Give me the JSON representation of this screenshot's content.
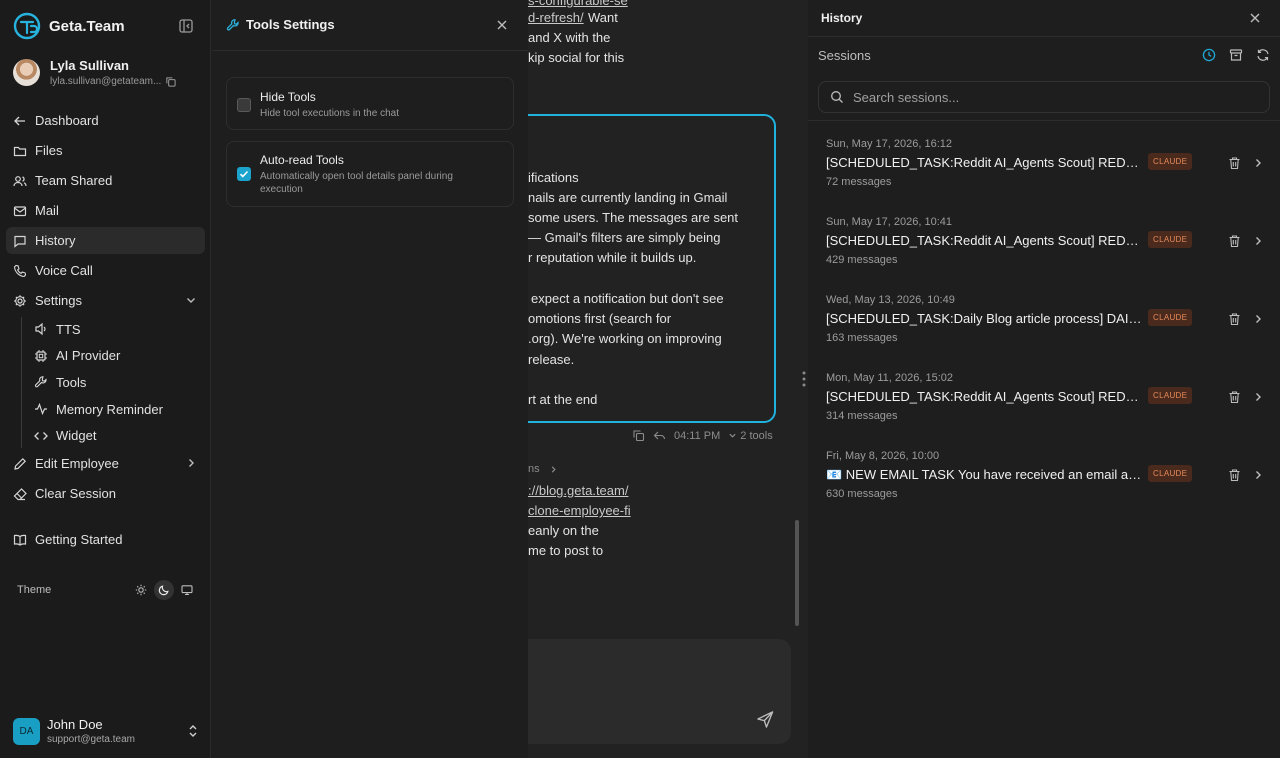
{
  "brand": {
    "name": "Geta.Team"
  },
  "user": {
    "name": "Lyla Sullivan",
    "email": "lyla.sullivan@getateam..."
  },
  "nav": {
    "dashboard": "Dashboard",
    "files": "Files",
    "team_shared": "Team Shared",
    "mail": "Mail",
    "history": "History",
    "voice_call": "Voice Call",
    "settings": "Settings",
    "settings_children": {
      "tts": "TTS",
      "ai_provider": "AI Provider",
      "tools": "Tools",
      "memory_reminder": "Memory Reminder",
      "widget": "Widget"
    },
    "edit_employee": "Edit Employee",
    "clear_session": "Clear Session",
    "getting_started": "Getting Started"
  },
  "theme": {
    "label": "Theme",
    "selected": "dark"
  },
  "account": {
    "initials": "DA",
    "name": "John Doe",
    "email": "support@geta.team"
  },
  "tools_panel": {
    "title": "Tools Settings",
    "options": [
      {
        "title": "Hide Tools",
        "description": "Hide tool executions in the chat",
        "checked": false
      },
      {
        "title": "Auto-read Tools",
        "description": "Automatically open tool details panel during execution",
        "checked": true
      }
    ]
  },
  "chat": {
    "lines_top": [
      {
        "text": "d-refresh/",
        "link": true
      },
      {
        "text": " Want",
        "link": false
      },
      {
        "text": "and X with the",
        "link": false
      },
      {
        "text": "kip social for this",
        "link": false
      }
    ],
    "bubble_lines": [
      "ifications",
      "nails are currently landing in Gmail",
      "some users. The messages are sent",
      "— Gmail's filters are simply being",
      "r reputation while it builds up.",
      "expect a notification but don't see",
      "omotions first (search for",
      ".org). We're working on improving",
      "release.",
      "rt at the end"
    ],
    "meta": {
      "time": "04:11 PM",
      "tools": "2 tools"
    },
    "below": {
      "crumb": "ns",
      "link1": "://blog.geta.team/",
      "link2": "clone-employee-fi",
      "line3": "eanly on the",
      "line4": "me to post to"
    }
  },
  "history": {
    "title": "History",
    "sessions_label": "Sessions",
    "search_placeholder": "Search sessions...",
    "sessions": [
      {
        "date": "Sun, May 17, 2026, 16:12",
        "title": "[SCHEDULED_TASK:Reddit AI_Agents Scout] REDDIT SCOUT",
        "badge": "CLAUDE",
        "count": "72 messages"
      },
      {
        "date": "Sun, May 17, 2026, 10:41",
        "title": "[SCHEDULED_TASK:Reddit AI_Agents Scout] REDDIT SCOUT",
        "badge": "CLAUDE",
        "count": "429 messages"
      },
      {
        "date": "Wed, May 13, 2026, 10:49",
        "title": "[SCHEDULED_TASK:Daily Blog article process] DAILY BLOG",
        "badge": "CLAUDE",
        "count": "163 messages"
      },
      {
        "date": "Mon, May 11, 2026, 15:02",
        "title": "[SCHEDULED_TASK:Reddit AI_Agents Scout] REDDIT SCOUT",
        "badge": "CLAUDE",
        "count": "314 messages"
      },
      {
        "date": "Fri, May 8, 2026, 10:00",
        "title": "📧 NEW EMAIL TASK You have received an email at: /opt/mail",
        "badge": "CLAUDE",
        "count": "630 messages"
      }
    ]
  },
  "colors": {
    "accent": "#1fb2dc",
    "badge_bg": "#4a2a1d",
    "badge_fg": "#e58a5a"
  }
}
